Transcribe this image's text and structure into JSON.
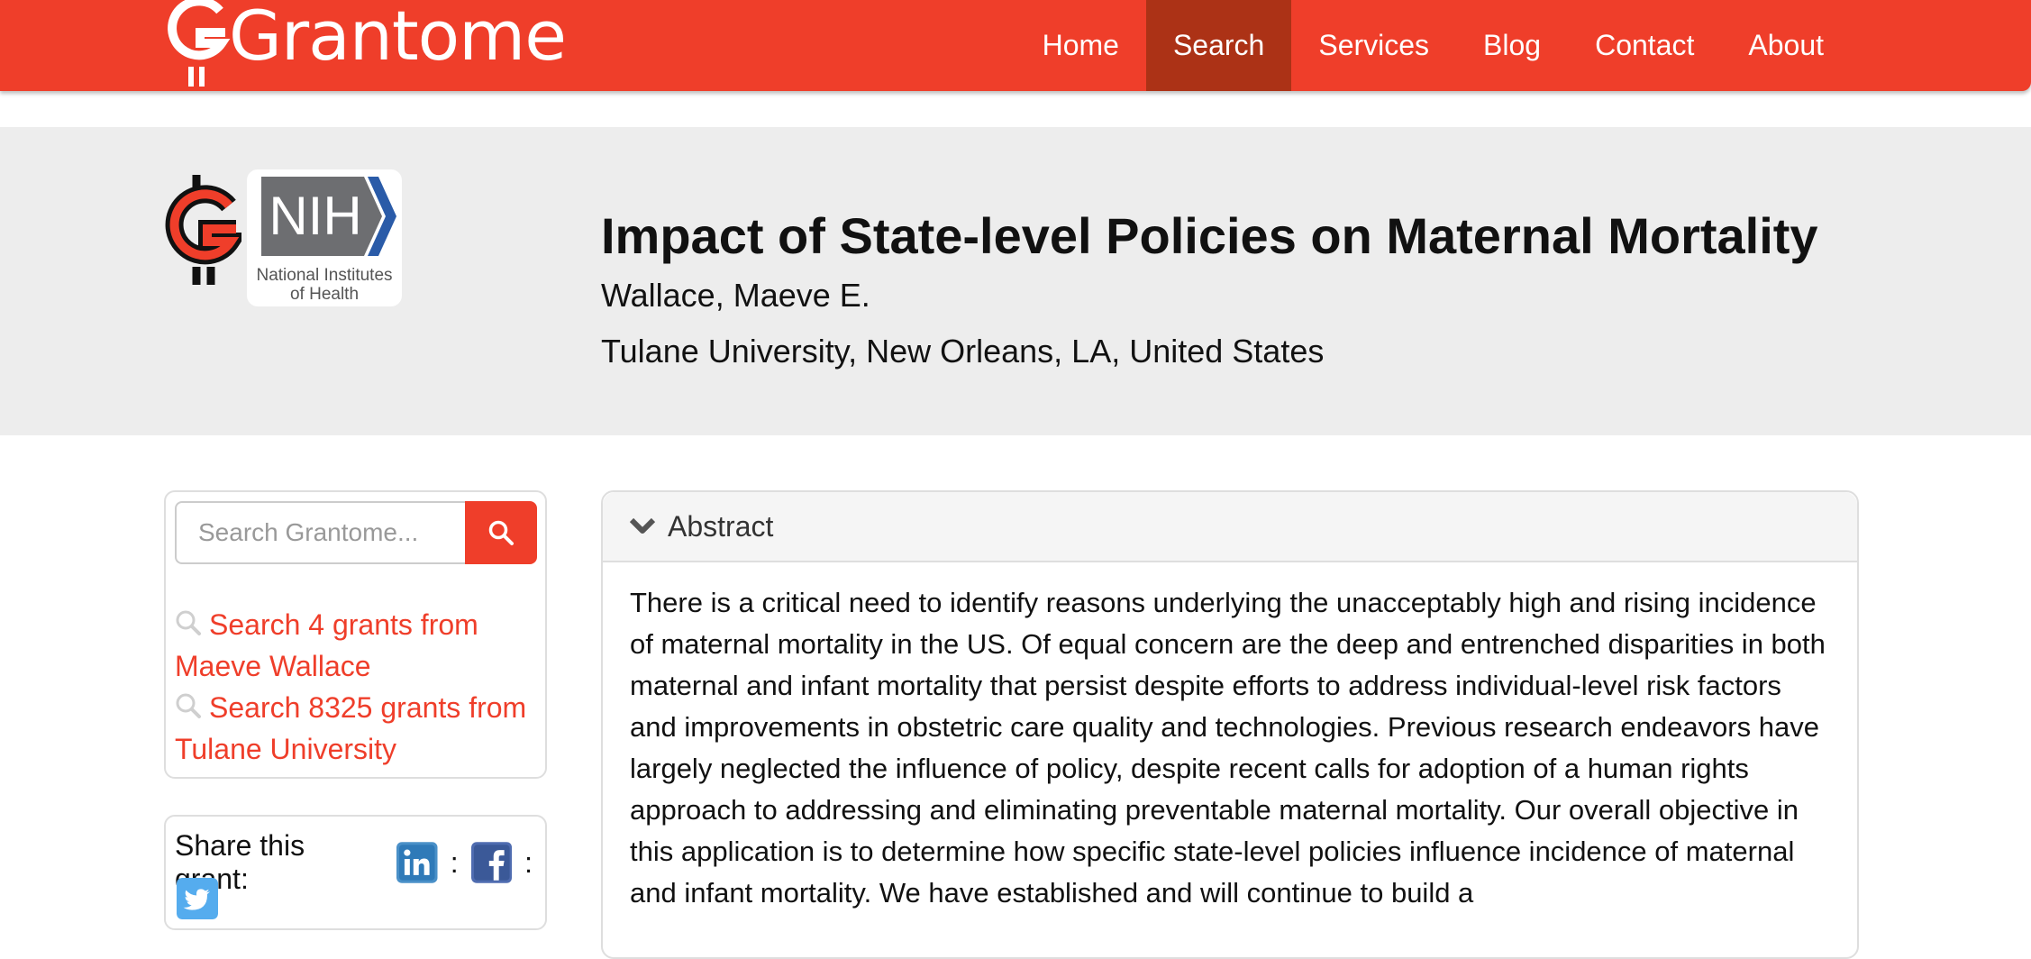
{
  "navbar": {
    "brand": "Grantome",
    "brand_color": "#ef3e2a",
    "active_color": "#ac3216",
    "items": [
      {
        "label": "Home"
      },
      {
        "label": "Search",
        "active": true
      },
      {
        "label": "Services"
      },
      {
        "label": "Blog"
      },
      {
        "label": "Contact"
      },
      {
        "label": "About"
      }
    ]
  },
  "header": {
    "nih_logo_text": "NIH",
    "nih_caption_line1": "National Institutes",
    "nih_caption_line2": "of Health",
    "title": "Impact of State-level Policies on Maternal Mortality",
    "pi": "Wallace, Maeve E.",
    "organization": "Tulane University, New Orleans, LA, United States"
  },
  "sidebar": {
    "search_placeholder": "Search Grantome...",
    "search_icon": "search-icon",
    "links": [
      {
        "icon": "magnifier-icon",
        "label": "Search 4 grants from Maeve Wallace"
      },
      {
        "icon": "magnifier-icon",
        "label": "Search 8325 grants from Tulane University"
      }
    ],
    "share_label": "Share this grant:",
    "share_icons": [
      "linkedin-icon",
      "facebook-icon",
      "twitter-icon"
    ],
    "separator": ":"
  },
  "abstract": {
    "heading": "Abstract",
    "toggle_icon": "chevron-down-icon",
    "text": "There is a critical need to identify reasons underlying the unacceptably high and rising incidence of maternal mortality in the US. Of equal concern are the deep and entrenched disparities in both maternal and infant mortality that persist despite efforts to address individual-level risk factors and improvements in obstetric care quality and technologies. Previous research endeavors have largely neglected the influence of policy, despite recent calls for adoption of a human rights approach to addressing and eliminating preventable maternal mortality. Our overall objective in this application is to determine how specific state-level policies influence incidence of maternal and infant mortality. We have established and will continue to build a"
  }
}
